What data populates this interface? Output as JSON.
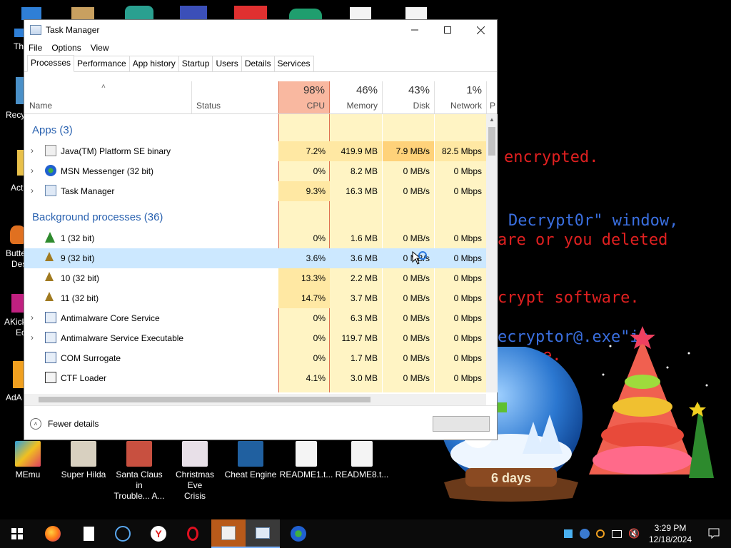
{
  "desktop": {
    "top_icons": [],
    "left_labels": [
      "Th",
      "Recy",
      "Act",
      "Butte",
      "Des",
      "AKick",
      "Ec",
      "AdA"
    ],
    "bottom_icons": [
      {
        "label1": "MEmu",
        "label2": ""
      },
      {
        "label1": "Super Hilda",
        "label2": ""
      },
      {
        "label1": "Santa Claus in",
        "label2": "Trouble... A..."
      },
      {
        "label1": "Christmas Eve",
        "label2": "Crisis"
      },
      {
        "label1": "Cheat Engine",
        "label2": ""
      },
      {
        "label1": "README1.t...",
        "label2": ""
      },
      {
        "label1": "README8.t...",
        "label2": ""
      }
    ],
    "ransom_lines": [
      "encrypted.",
      "Decrypt0r\" window,",
      "are or you deleted",
      "crypt software.",
      "ecryptor@.exe\"in",
      "e."
    ],
    "globe_text": "6 days"
  },
  "window": {
    "title": "Task Manager",
    "menu": [
      "File",
      "Options",
      "View"
    ],
    "tabs": [
      "Processes",
      "Performance",
      "App history",
      "Startup",
      "Users",
      "Details",
      "Services"
    ],
    "columns": {
      "name": "Name",
      "status": "Status",
      "cpu_pct": "98%",
      "cpu": "CPU",
      "mem_pct": "46%",
      "mem": "Memory",
      "disk_pct": "43%",
      "disk": "Disk",
      "net_pct": "1%",
      "net": "Network",
      "power_cut": "P"
    },
    "groups": {
      "apps": "Apps (3)",
      "background": "Background processes (36)"
    },
    "apps": [
      {
        "name": "Java(TM) Platform SE binary",
        "cpu": "7.2%",
        "mem": "419.9 MB",
        "disk": "7.9 MB/s",
        "net": "82.5 Mbps"
      },
      {
        "name": "MSN Messenger (32 bit)",
        "cpu": "0%",
        "mem": "8.2 MB",
        "disk": "0 MB/s",
        "net": "0 Mbps"
      },
      {
        "name": "Task Manager",
        "cpu": "9.3%",
        "mem": "16.3 MB",
        "disk": "0 MB/s",
        "net": "0 Mbps"
      }
    ],
    "background": [
      {
        "name": "1 (32 bit)",
        "cpu": "0%",
        "mem": "1.6 MB",
        "disk": "0 MB/s",
        "net": "0 Mbps"
      },
      {
        "name": "9 (32 bit)",
        "cpu": "3.6%",
        "mem": "3.6 MB",
        "disk": "0 MB/s",
        "net": "0 Mbps"
      },
      {
        "name": "10 (32 bit)",
        "cpu": "13.3%",
        "mem": "2.2 MB",
        "disk": "0 MB/s",
        "net": "0 Mbps"
      },
      {
        "name": "11 (32 bit)",
        "cpu": "14.7%",
        "mem": "3.7 MB",
        "disk": "0 MB/s",
        "net": "0 Mbps"
      },
      {
        "name": "Antimalware Core Service",
        "cpu": "0%",
        "mem": "6.3 MB",
        "disk": "0 MB/s",
        "net": "0 Mbps"
      },
      {
        "name": "Antimalware Service Executable",
        "cpu": "0%",
        "mem": "119.7 MB",
        "disk": "0 MB/s",
        "net": "0 Mbps"
      },
      {
        "name": "COM Surrogate",
        "cpu": "0%",
        "mem": "1.7 MB",
        "disk": "0 MB/s",
        "net": "0 Mbps"
      },
      {
        "name": "CTF Loader",
        "cpu": "4.1%",
        "mem": "3.0 MB",
        "disk": "0 MB/s",
        "net": "0 Mbps"
      }
    ],
    "fewer_details": "Fewer details"
  },
  "taskbar": {
    "time": "3:29 PM",
    "date": "12/18/2024"
  },
  "colors": {
    "cpu_header": "#f9b8a0",
    "cell_light": "#fff4c4",
    "cell_mid": "#ffe8a3",
    "cell_hot": "#ffd27a",
    "selected": "#cce8ff",
    "group_text": "#2a62b0"
  }
}
